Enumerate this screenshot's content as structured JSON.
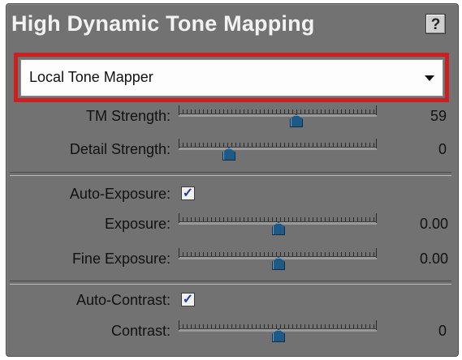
{
  "panel": {
    "title": "High Dynamic Tone Mapping",
    "help_label": "?"
  },
  "mapper": {
    "selected": "Local Tone Mapper"
  },
  "tone": {
    "strength_label": "TM Strength:",
    "strength_value": "59",
    "strength_fraction": 0.59,
    "detail_label": "Detail Strength:",
    "detail_value": "0",
    "detail_fraction": 0.25
  },
  "exposure": {
    "auto_label": "Auto-Exposure:",
    "auto_checked": true,
    "exposure_label": "Exposure:",
    "exposure_value": "0.00",
    "exposure_fraction": 0.5,
    "fine_label": "Fine Exposure:",
    "fine_value": "0.00",
    "fine_fraction": 0.5
  },
  "contrast": {
    "auto_label": "Auto-Contrast:",
    "auto_checked": true,
    "contrast_label": "Contrast:",
    "contrast_value": "0",
    "contrast_fraction": 0.5
  },
  "colors": {
    "panel_bg": "#727272",
    "highlight": "#cc1f1f",
    "thumb": "#1f5a87"
  },
  "icons": {
    "help": "help-icon",
    "dropdown": "chevron-down-icon",
    "check": "checkmark-icon"
  }
}
